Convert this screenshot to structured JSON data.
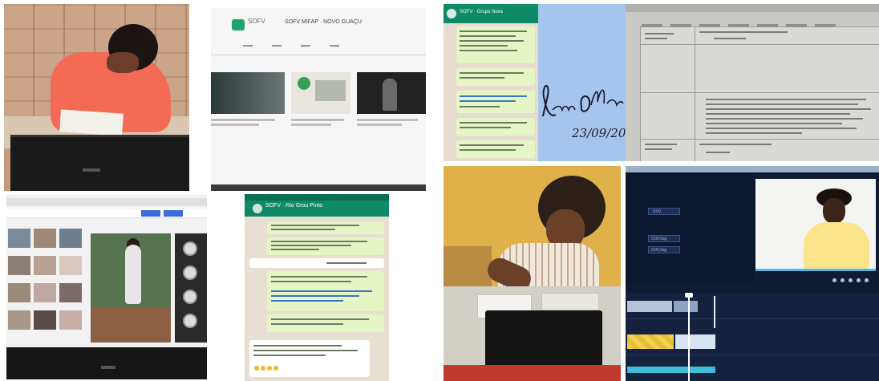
{
  "collage": {
    "tiles": [
      {
        "id": "photo-writing",
        "subject": "person writing in front of a laptop"
      },
      {
        "id": "channel-page",
        "subject": "video channel page on a monitor"
      },
      {
        "id": "video-feed",
        "subject": "short video feed on a laptop"
      },
      {
        "id": "chat-1",
        "subject": "group chat conversation on phone"
      },
      {
        "id": "chat-2",
        "subject": "group chat conversation on phone"
      },
      {
        "id": "signature",
        "subject": "handwritten signature and date"
      },
      {
        "id": "document",
        "subject": "planning form on screen"
      },
      {
        "id": "photo-desk",
        "subject": "person studying at desk with laptop"
      },
      {
        "id": "video-editor",
        "subject": "video editing software with preview"
      }
    ]
  },
  "channel": {
    "name": "SOFV",
    "title": "SOFV MIFAP · NOVO GUAÇU"
  },
  "chat1": {
    "header": "SOFV · Rio Grou Pinto"
  },
  "chat2": {
    "header": "SOFV · Grupo Nova"
  },
  "signature": {
    "name": "Vanessa Otto",
    "date": "23/09/20"
  },
  "editor": {
    "labels": [
      "0:00",
      "0:00,0sg",
      "0:00,0sg"
    ]
  },
  "colors": {
    "chat_header": "#0e8a67",
    "chat_bubble": "#e6f5c4",
    "signature_bg": "#a5c5ec",
    "editor_bg": "#0f1a33",
    "editor_accent": "#56b8e6"
  }
}
